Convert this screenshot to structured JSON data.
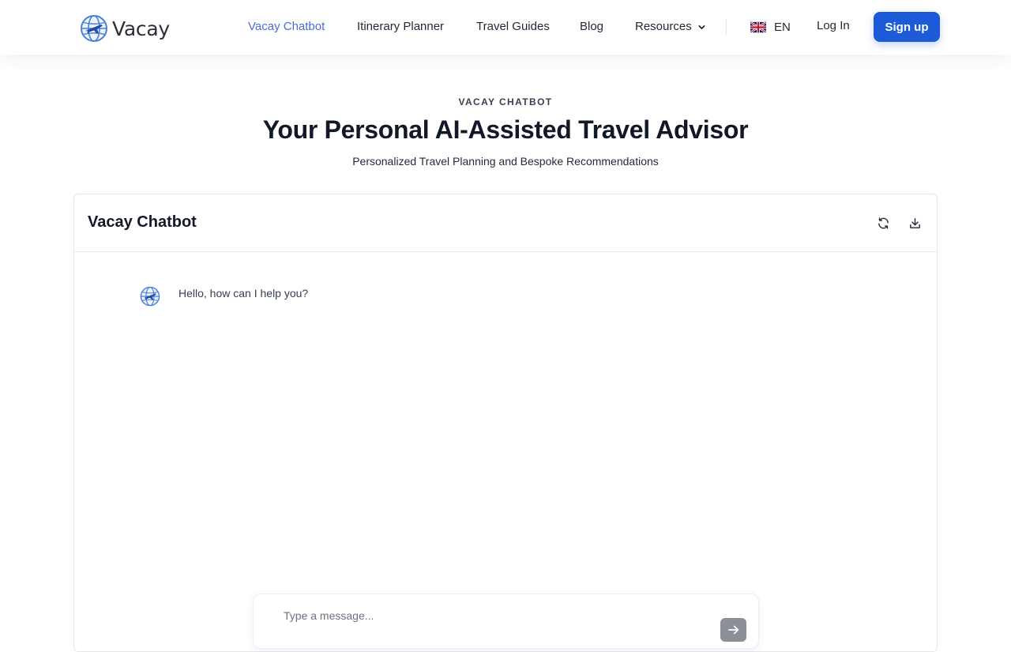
{
  "header": {
    "logo_text": "Vacay",
    "logo_icon": "globe-plane-icon",
    "nav": [
      {
        "label": "Vacay Chatbot",
        "active": true
      },
      {
        "label": "Itinerary Planner",
        "active": false
      },
      {
        "label": "Travel Guides",
        "active": false
      },
      {
        "label": "Blog",
        "active": false
      },
      {
        "label": "Resources",
        "active": false
      }
    ],
    "language": {
      "code": "EN",
      "flag_icon": "uk-flag-icon"
    },
    "login_label": "Log In",
    "signup_label": "Sign up"
  },
  "hero": {
    "eyebrow": "VACAY CHATBOT",
    "title": "Your Personal AI-Assisted Travel Advisor",
    "subtitle": "Personalized Travel Planning and Bespoke Recommendations"
  },
  "chat": {
    "title": "Vacay Chatbot",
    "actions": [
      {
        "icon": "refresh-icon"
      },
      {
        "icon": "download-icon"
      }
    ],
    "messages": [
      {
        "sender": "bot",
        "avatar_icon": "globe-plane-icon",
        "text": "Hello, how can I help you?"
      }
    ],
    "composer": {
      "placeholder": "Type a message...",
      "value": "",
      "send_icon": "arrow-right-icon"
    }
  },
  "colors": {
    "accent": "#1d5ad8",
    "active_nav": "#4f6bd8",
    "send_button": "#8b8f96"
  }
}
